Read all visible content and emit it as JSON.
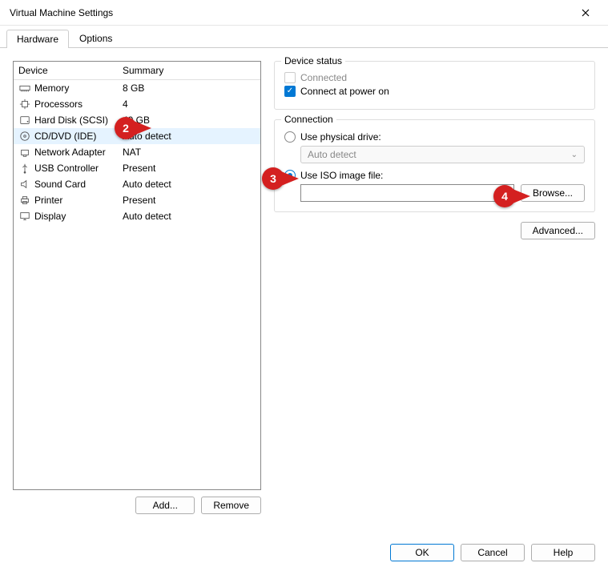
{
  "window": {
    "title": "Virtual Machine Settings"
  },
  "tabs": {
    "hardware": "Hardware",
    "options": "Options"
  },
  "columns": {
    "device": "Device",
    "summary": "Summary"
  },
  "devices": [
    {
      "name": "Memory",
      "summary": "8 GB",
      "icon": "memory"
    },
    {
      "name": "Processors",
      "summary": "4",
      "icon": "cpu"
    },
    {
      "name": "Hard Disk (SCSI)",
      "summary": "40 GB",
      "icon": "hdd"
    },
    {
      "name": "CD/DVD (IDE)",
      "summary": "Auto detect",
      "icon": "cd",
      "selected": true
    },
    {
      "name": "Network Adapter",
      "summary": "NAT",
      "icon": "net"
    },
    {
      "name": "USB Controller",
      "summary": "Present",
      "icon": "usb"
    },
    {
      "name": "Sound Card",
      "summary": "Auto detect",
      "icon": "sound"
    },
    {
      "name": "Printer",
      "summary": "Present",
      "icon": "printer"
    },
    {
      "name": "Display",
      "summary": "Auto detect",
      "icon": "display"
    }
  ],
  "buttons": {
    "add": "Add...",
    "remove": "Remove",
    "browse": "Browse...",
    "advanced": "Advanced...",
    "ok": "OK",
    "cancel": "Cancel",
    "help": "Help"
  },
  "status": {
    "group": "Device status",
    "connected": "Connected",
    "powerOn": "Connect at power on"
  },
  "connection": {
    "group": "Connection",
    "physical": "Use physical drive:",
    "physicalCombo": "Auto detect",
    "iso": "Use ISO image file:",
    "isoValue": ""
  },
  "callouts": {
    "c2": "2",
    "c3": "3",
    "c4": "4"
  }
}
